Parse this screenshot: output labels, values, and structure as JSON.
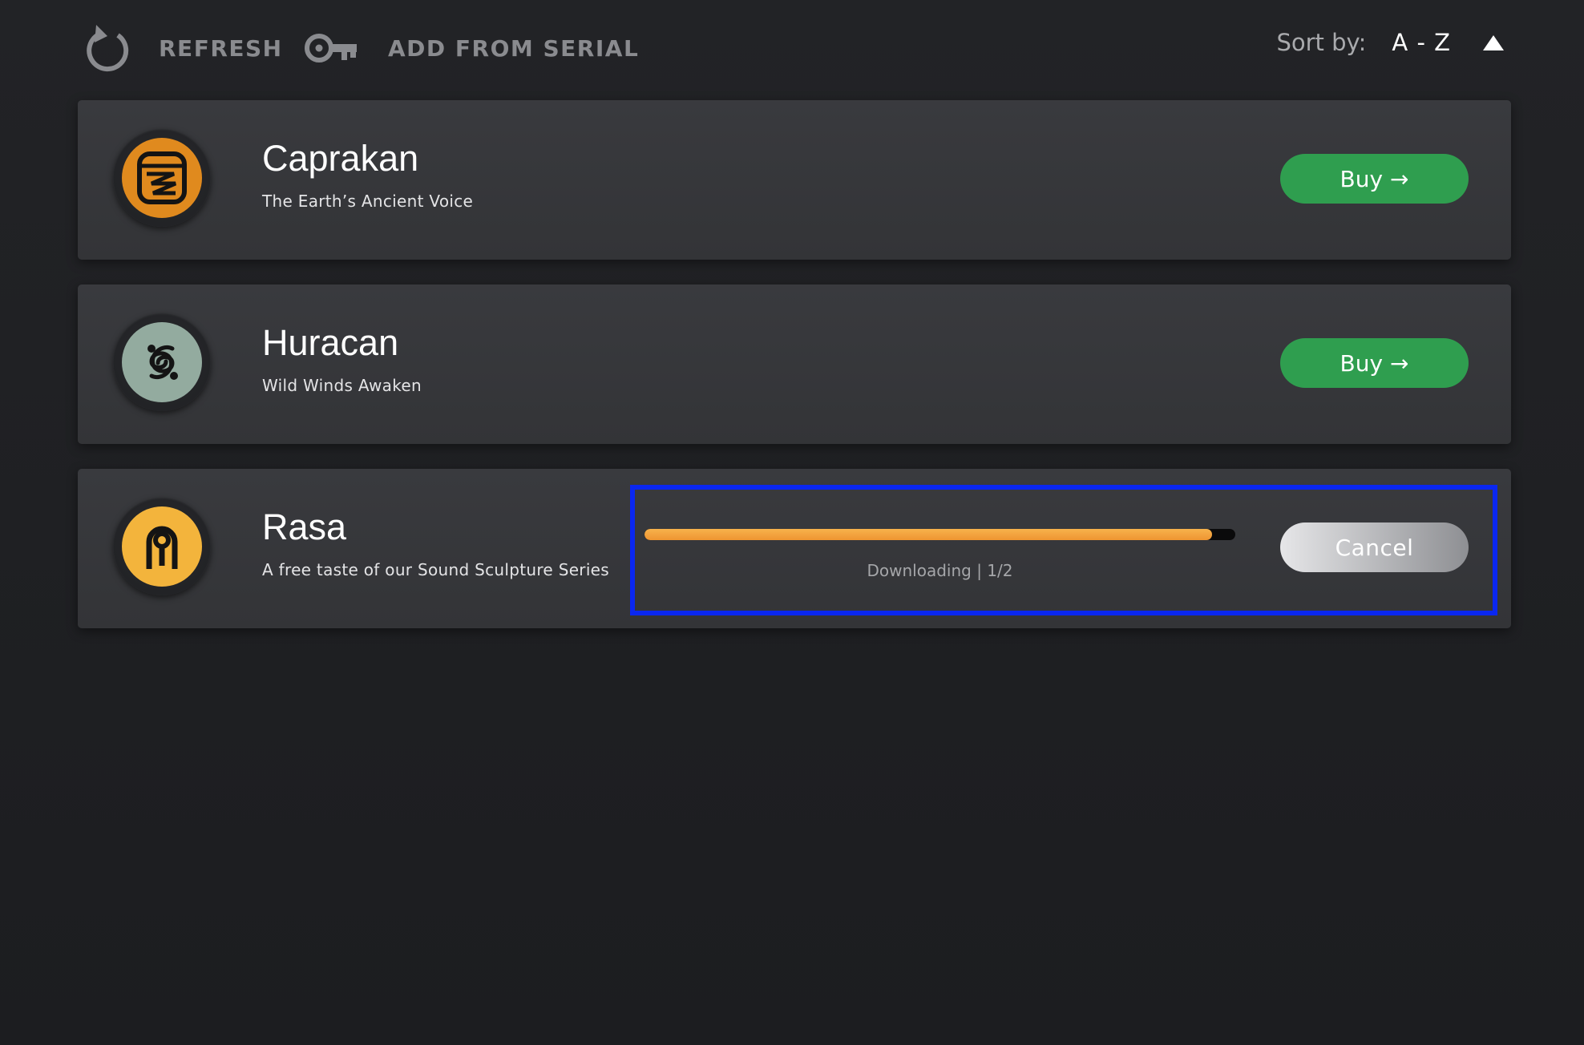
{
  "toolbar": {
    "refresh_label": "REFRESH",
    "add_serial_label": "ADD FROM SERIAL",
    "sort_label": "Sort by:",
    "sort_value": "A - Z",
    "sort_direction": "ascending",
    "icons": {
      "refresh": "refresh-icon",
      "serial": "key-icon",
      "sort": "triangle-up-icon"
    }
  },
  "products": [
    {
      "name": "Caprakan",
      "subtitle": "The Earth’s Ancient Voice",
      "action_label": "Buy →",
      "logo_icon": "caprakan-logo-icon",
      "logo_color": "#e08a1e"
    },
    {
      "name": "Huracan",
      "subtitle": "Wild Winds Awaken",
      "action_label": "Buy →",
      "logo_icon": "huracan-logo-icon",
      "logo_color": "#93ab9f"
    },
    {
      "name": "Rasa",
      "subtitle": "A free taste of our Sound Sculpture Series",
      "action_label": "Cancel",
      "logo_icon": "rasa-logo-icon",
      "logo_color": "#f3b43c",
      "download": {
        "progress": 0.96,
        "status": "Downloading | 1/2"
      }
    }
  ],
  "colors": {
    "background": "#1f2023",
    "card": "#36373a",
    "buy_button": "#2f9e4f",
    "progress": "#f2a23c",
    "highlight": "#0a27f0"
  }
}
